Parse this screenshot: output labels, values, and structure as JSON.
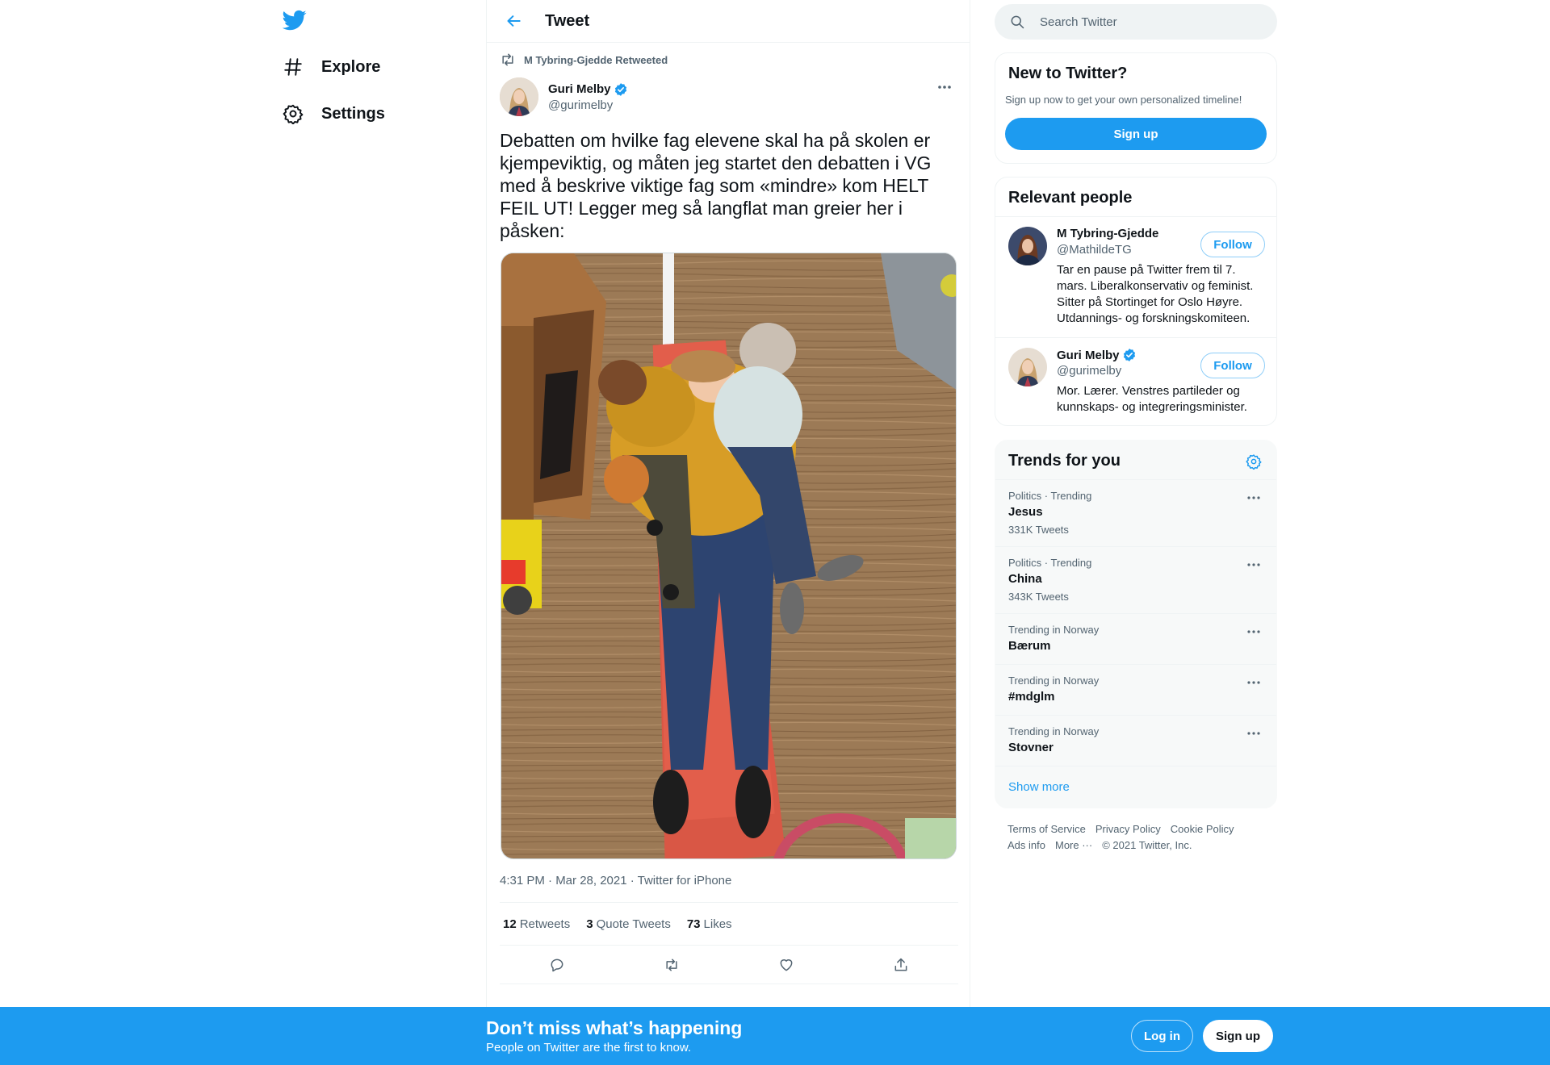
{
  "nav": {
    "logo_icon": "twitter-bird-icon",
    "items": [
      {
        "label": "Explore",
        "icon": "hashtag-icon"
      },
      {
        "label": "Settings",
        "icon": "gear-icon"
      }
    ]
  },
  "header": {
    "title": "Tweet",
    "back_icon": "arrow-left-icon"
  },
  "tweet": {
    "retweeted_by": "M Tybring-Gjedde Retweeted",
    "author_name": "Guri Melby",
    "author_handle": "@gurimelby",
    "text": "Debatten om hvilke fag elevene skal ha på skolen er kjempeviktig, og måten jeg startet den debatten i VG med å beskrive viktige fag som «mindre» kom HELT FEIL UT! Legger meg så langflat man greier her i påsken:",
    "timestamp": "4:31 PM · Mar 28, 2021 · Twitter for iPhone",
    "stats": {
      "retweets": "12",
      "retweets_label": "Retweets",
      "quotes": "3",
      "quotes_label": "Quote Tweets",
      "likes": "73",
      "likes_label": "Likes"
    }
  },
  "search": {
    "placeholder": "Search Twitter"
  },
  "new_to_twitter": {
    "title": "New to Twitter?",
    "subtitle": "Sign up now to get your own personalized timeline!",
    "button": "Sign up"
  },
  "relevant_people": {
    "title": "Relevant people",
    "people": [
      {
        "name": "M Tybring-Gjedde",
        "handle": "@MathildeTG",
        "bio": "Tar en pause på Twitter frem til 7. mars. Liberalkonservativ og feminist. Sitter på Stortinget for Oslo Høyre. Utdannings- og forskningskomiteen.",
        "follow": "Follow"
      },
      {
        "name": "Guri Melby",
        "handle": "@gurimelby",
        "bio": "Mor. Lærer. Venstres partileder og kunnskaps- og integreringsminister.",
        "follow": "Follow"
      }
    ]
  },
  "trends": {
    "title": "Trends for you",
    "items": [
      {
        "context": "Politics · Trending",
        "name": "Jesus",
        "count": "331K Tweets"
      },
      {
        "context": "Politics · Trending",
        "name": "China",
        "count": "343K Tweets"
      },
      {
        "context": "Trending in Norway",
        "name": "Bærum",
        "count": ""
      },
      {
        "context": "Trending in Norway",
        "name": "#mdglm",
        "count": ""
      },
      {
        "context": "Trending in Norway",
        "name": "Stovner",
        "count": ""
      }
    ],
    "show_more": "Show more"
  },
  "footer": {
    "terms": "Terms of Service",
    "privacy": "Privacy Policy",
    "cookie": "Cookie Policy",
    "ads": "Ads info",
    "more": "More ···",
    "copyright": "© 2021 Twitter, Inc."
  },
  "bottom_bar": {
    "title": "Don’t miss what’s happening",
    "subtitle": "People on Twitter are the first to know.",
    "login": "Log in",
    "signup": "Sign up"
  },
  "colors": {
    "accent": "#1d9bf0",
    "text": "#0f1419",
    "muted": "#536471"
  }
}
